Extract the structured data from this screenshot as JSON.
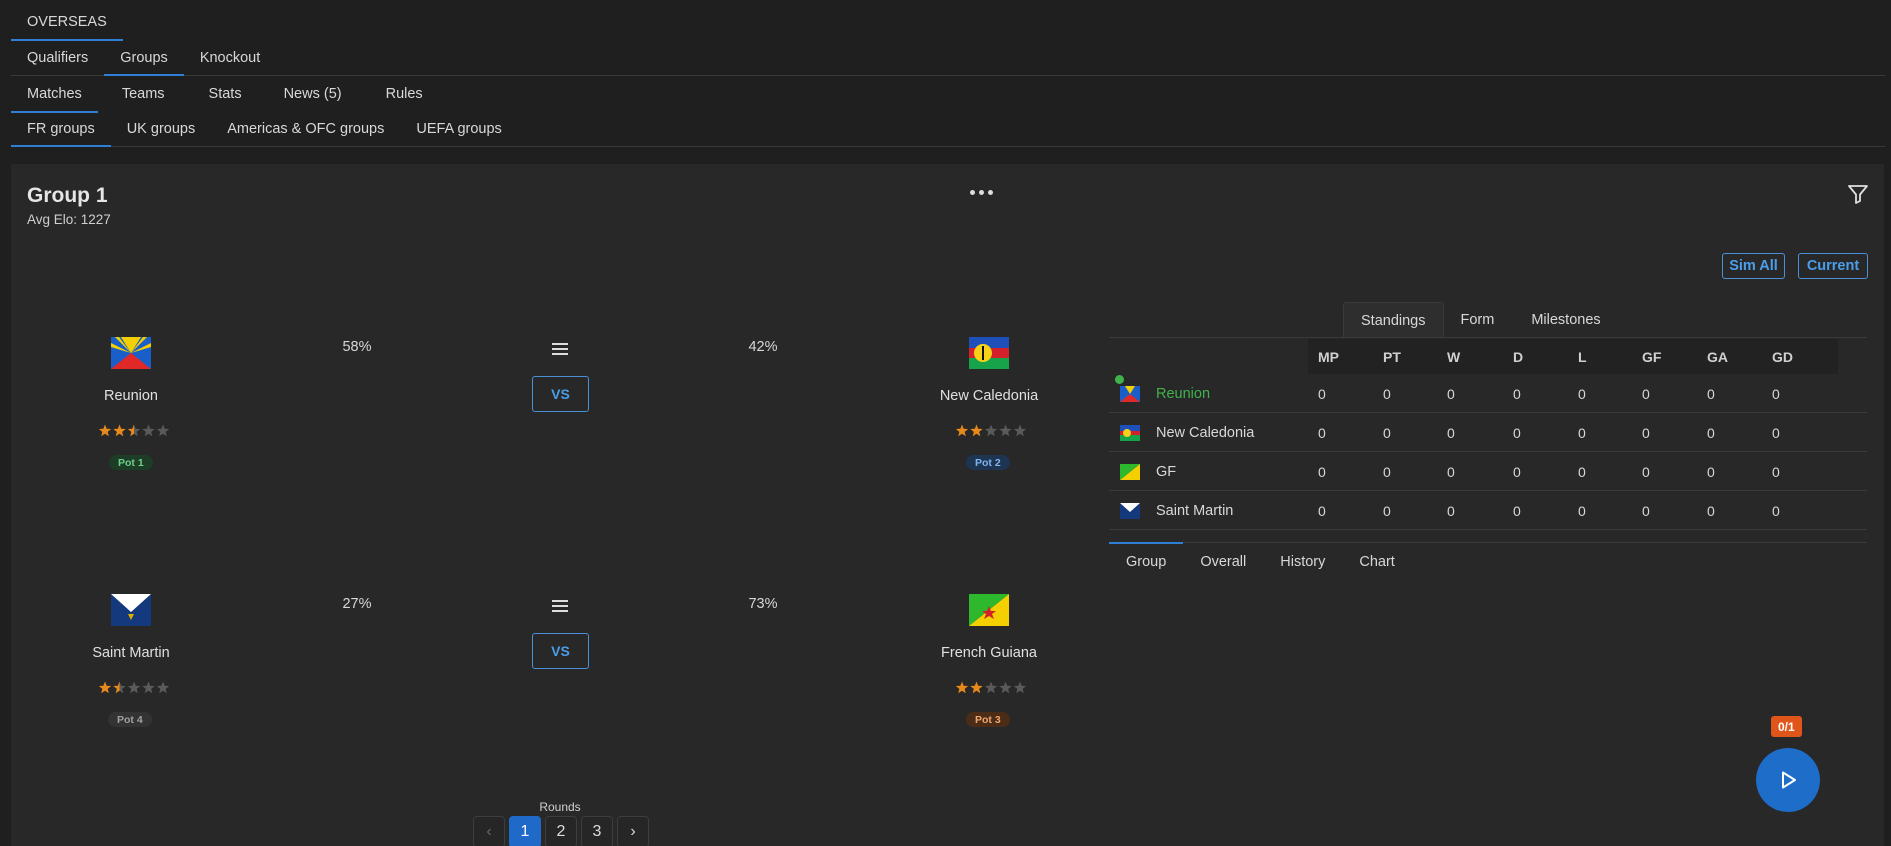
{
  "nav": {
    "top": [
      "OVERSEAS"
    ],
    "stage": [
      "Qualifiers",
      "Groups",
      "Knockout"
    ],
    "section": [
      "Matches",
      "Teams",
      "Stats",
      "News (5)",
      "Rules"
    ],
    "groups": [
      "FR groups",
      "UK groups",
      "Americas & OFC groups",
      "UEFA groups"
    ]
  },
  "group": {
    "title": "Group 1",
    "avg_elo": "Avg Elo: 1227",
    "sim_all": "Sim All",
    "current": "Current"
  },
  "matches": [
    {
      "home": {
        "name": "Reunion",
        "stars": 2.5,
        "pot": "Pot 1"
      },
      "away": {
        "name": "New Caledonia",
        "stars": 2,
        "pot": "Pot 2"
      },
      "home_pct": "58%",
      "away_pct": "42%",
      "vs": "VS"
    },
    {
      "home": {
        "name": "Saint Martin",
        "stars": 1.5,
        "pot": "Pot 4"
      },
      "away": {
        "name": "French Guiana",
        "stars": 2,
        "pot": "Pot 3"
      },
      "home_pct": "27%",
      "away_pct": "73%",
      "vs": "VS"
    }
  ],
  "standings": {
    "tabs": [
      "Standings",
      "Form",
      "Milestones"
    ],
    "columns": [
      "MP",
      "PT",
      "W",
      "D",
      "L",
      "GF",
      "GA",
      "GD"
    ],
    "rows": [
      {
        "team": "Reunion",
        "values": [
          "0",
          "0",
          "0",
          "0",
          "0",
          "0",
          "0",
          "0"
        ]
      },
      {
        "team": "New Caledonia",
        "values": [
          "0",
          "0",
          "0",
          "0",
          "0",
          "0",
          "0",
          "0"
        ]
      },
      {
        "team": "GF",
        "values": [
          "0",
          "0",
          "0",
          "0",
          "0",
          "0",
          "0",
          "0"
        ]
      },
      {
        "team": "Saint Martin",
        "values": [
          "0",
          "0",
          "0",
          "0",
          "0",
          "0",
          "0",
          "0"
        ]
      }
    ],
    "bottom_tabs": [
      "Group",
      "Overall",
      "History",
      "Chart"
    ]
  },
  "rounds": {
    "label": "Rounds",
    "pages": [
      "1",
      "2",
      "3"
    ],
    "prev": "‹",
    "next": "›"
  },
  "sim": {
    "progress": "0/1"
  },
  "colors": {
    "accent": "#2f7fd6",
    "leader": "#3fb24a",
    "star": "#e8891c",
    "pot1_bg": "#1d3d27",
    "pot1_fg": "#6fd08a",
    "pot2_bg": "#1e3552",
    "pot2_fg": "#7fb4f0",
    "pot3_bg": "#4a2c17",
    "pot3_fg": "#f0a66a",
    "pot4_bg": "#333333",
    "pot4_fg": "#a0a0a0"
  }
}
